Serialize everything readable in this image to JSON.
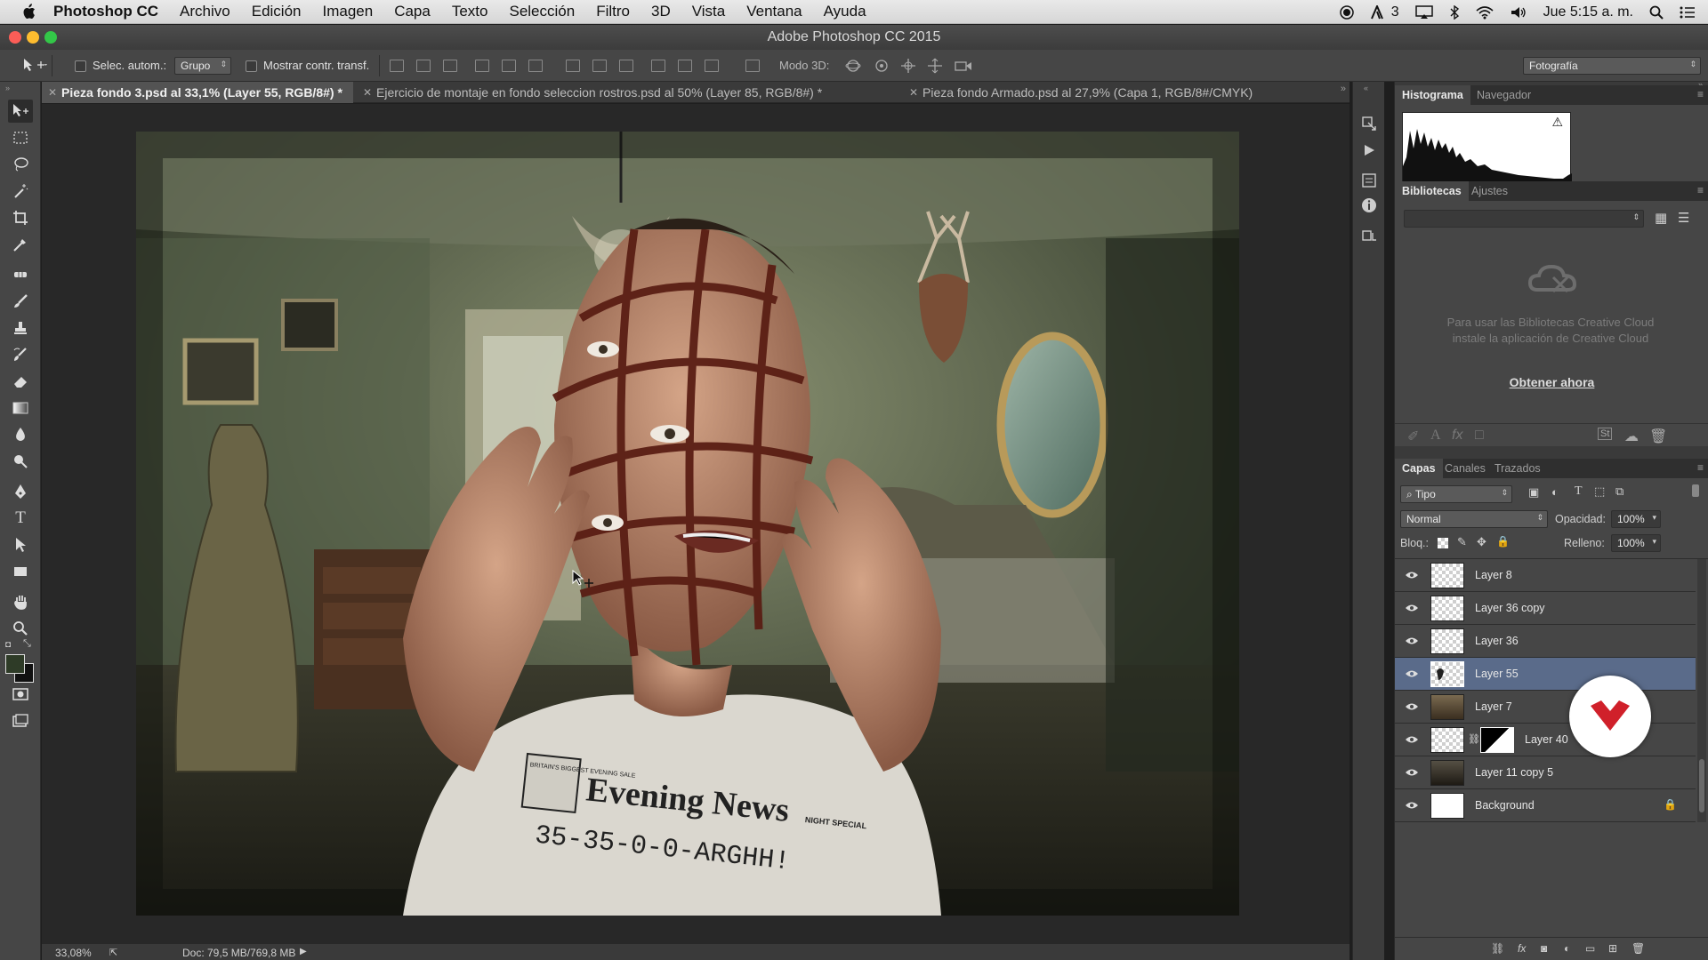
{
  "menubar": {
    "app": "Photoshop CC",
    "items": [
      "Archivo",
      "Edición",
      "Imagen",
      "Capa",
      "Texto",
      "Selección",
      "Filtro",
      "3D",
      "Vista",
      "Ventana",
      "Ayuda"
    ],
    "adobe_count": "3",
    "clock": "Jue 5:15 a. m."
  },
  "window": {
    "title": "Adobe Photoshop CC 2015"
  },
  "options": {
    "auto_select_label": "Selec. autom.:",
    "auto_select_value": "Grupo",
    "show_transform_label": "Mostrar contr. transf.",
    "mode3d_label": "Modo 3D:",
    "workspace": "Fotografía"
  },
  "tabs": [
    {
      "label": "Pieza fondo 3.psd al 33,1% (Layer 55, RGB/8#) *",
      "active": true
    },
    {
      "label": "Ejercicio de montaje en fondo seleccion rostros.psd al 50% (Layer 85, RGB/8#) *",
      "active": false
    },
    {
      "label": "Pieza fondo Armado.psd al 27,9% (Capa 1, RGB/8#/CMYK)",
      "active": false
    }
  ],
  "artwork": {
    "shirt_line1": "Evening News",
    "shirt_line2": "35-35-0-0-ARGHH!",
    "shirt_badge": "BRITAIN'S BIGGEST EVENING SALE",
    "shirt_badge2": "NIGHT SPECIAL"
  },
  "status": {
    "zoom": "33,08%",
    "doc": "Doc: 79,5 MB/769,8 MB"
  },
  "panels": {
    "histogram_tabs": [
      "Histograma",
      "Navegador"
    ],
    "library_tabs": [
      "Bibliotecas",
      "Ajustes"
    ],
    "library_message": "Para usar las Bibliotecas Creative Cloud instale la aplicación de Creative Cloud",
    "library_link": "Obtener ahora",
    "layers_tabs": [
      "Capas",
      "Canales",
      "Trazados"
    ],
    "filter_kind": "Tipo",
    "blend_mode": "Normal",
    "opacity_label": "Opacidad:",
    "opacity_value": "100%",
    "lock_label": "Bloq.:",
    "fill_label": "Relleno:",
    "fill_value": "100%",
    "layers": [
      {
        "name": "Layer 8",
        "thumb": "checker"
      },
      {
        "name": "Layer 36 copy",
        "thumb": "checker"
      },
      {
        "name": "Layer 36",
        "thumb": "checker"
      },
      {
        "name": "Layer 55",
        "thumb": "checker",
        "selected": true
      },
      {
        "name": "Layer 7",
        "thumb": "room"
      },
      {
        "name": "Layer 40",
        "thumb": "checker",
        "mask": true
      },
      {
        "name": "Layer 11 copy 5",
        "thumb": "room"
      },
      {
        "name": "Background",
        "thumb": "white",
        "locked": true
      }
    ]
  },
  "colors": {
    "accent_selected": "#5a6b8a",
    "logo_red": "#d0202a"
  }
}
